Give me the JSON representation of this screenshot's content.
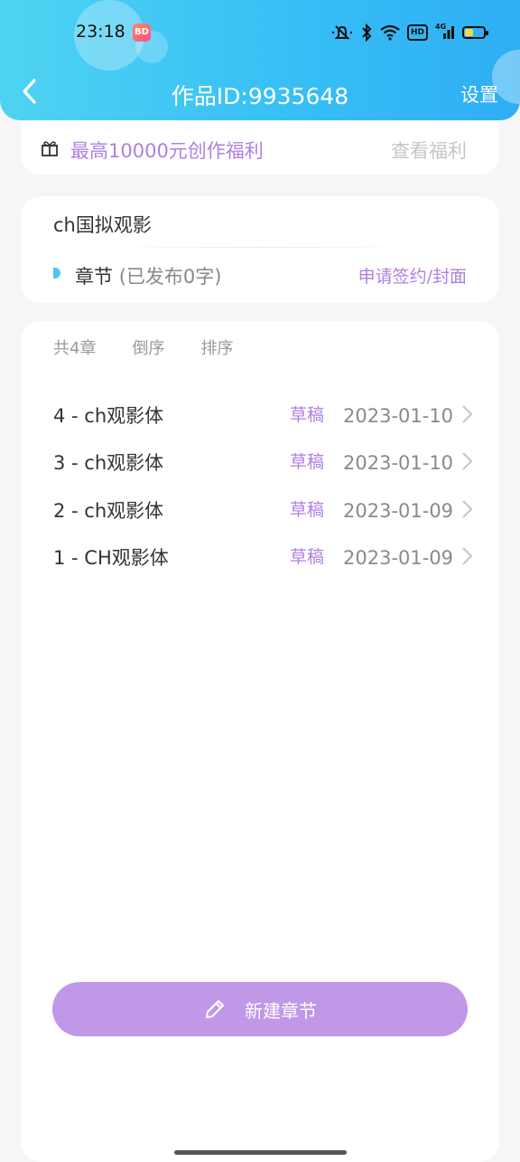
{
  "status_bar": {
    "time": "23:18",
    "app_badge": "BD",
    "icons": [
      "mute-icon",
      "bluetooth-icon",
      "wifi-icon",
      "hd-icon",
      "signal-4g-icon",
      "battery-icon"
    ],
    "hd_label": "HD",
    "network_label": "4G",
    "battery_level": 0.45
  },
  "header": {
    "back_icon": "chevron-left-icon",
    "title": "作品ID:9935648",
    "settings_label": "设置"
  },
  "benefit_banner": {
    "icon": "gift-icon",
    "text": "最高10000元创作福利",
    "link_label": "查看福利"
  },
  "work_info": {
    "name": "ch国拟观影",
    "chapter_label": "章节",
    "published_text": "(已发布0字)",
    "sign_link": "申请签约/封面"
  },
  "chapter_list": {
    "count_label": "共4章",
    "reverse_label": "倒序",
    "sort_label": "排序",
    "rows": [
      {
        "title": "4 - ch观影体",
        "status": "草稿",
        "date": "2023-01-10"
      },
      {
        "title": "3 - ch观影体",
        "status": "草稿",
        "date": "2023-01-10"
      },
      {
        "title": "2 - ch观影体",
        "status": "草稿",
        "date": "2023-01-09"
      },
      {
        "title": "1 - CH观影体",
        "status": "草稿",
        "date": "2023-01-09"
      }
    ]
  },
  "new_chapter_button": {
    "icon": "pencil-icon",
    "label": "新建章节"
  },
  "colors": {
    "header_gradient_start": "#4fd3f2",
    "header_gradient_end": "#2eaef5",
    "accent_purple": "#b07fe0",
    "button_purple": "#c197e8"
  }
}
